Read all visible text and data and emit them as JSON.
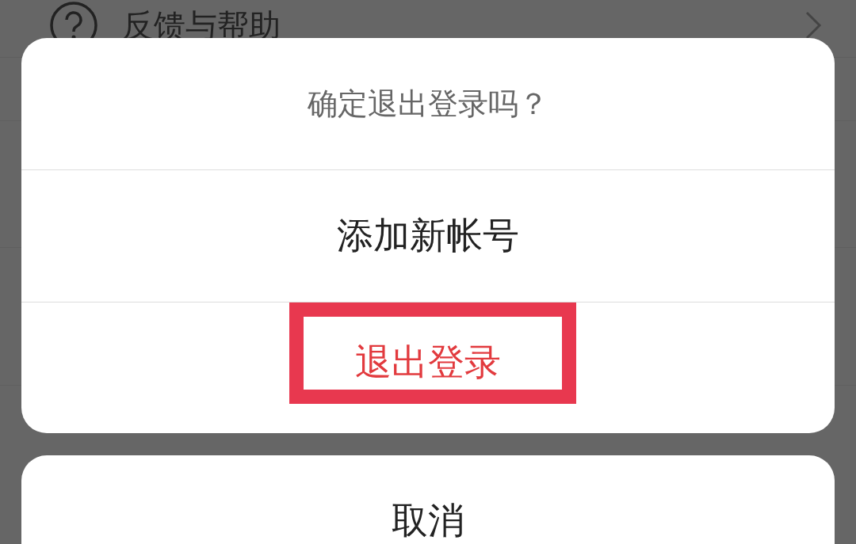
{
  "background_list": {
    "items": [
      {
        "label": "反馈与帮助"
      }
    ]
  },
  "dialog": {
    "title": "确定退出登录吗？",
    "options": [
      {
        "label": "添加新帐号",
        "kind": "normal"
      },
      {
        "label": "退出登录",
        "kind": "destructive",
        "highlighted": true
      }
    ]
  },
  "cancel": {
    "label": "取消"
  }
}
